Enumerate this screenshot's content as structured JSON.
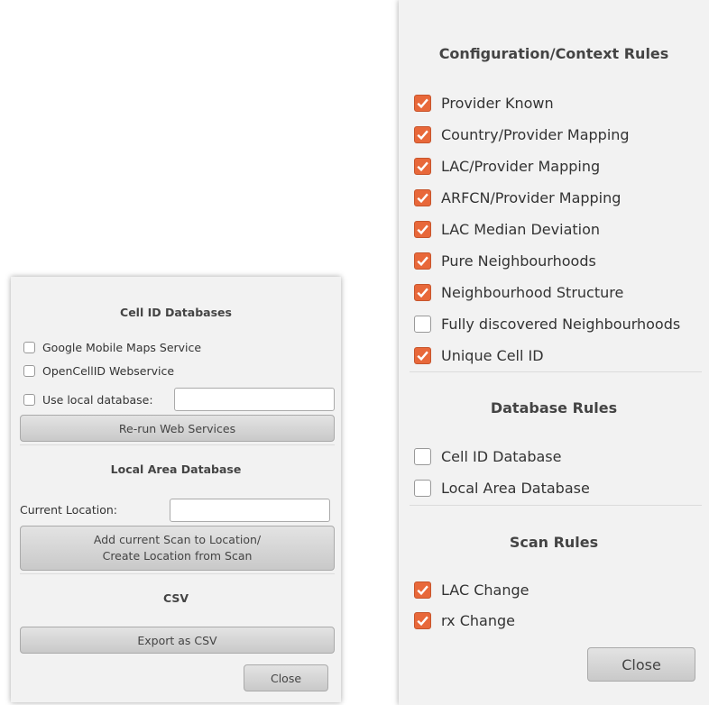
{
  "left_dialog": {
    "cell_id_title": "Cell ID Databases",
    "options": [
      {
        "label": "Google Mobile Maps Service",
        "checked": false
      },
      {
        "label": "OpenCellID Webservice",
        "checked": false
      },
      {
        "label": "Use local database:",
        "checked": false
      }
    ],
    "local_db_value": "",
    "rerun_button": "Re-run Web Services",
    "local_area_title": "Local Area Database",
    "current_location_label": "Current Location:",
    "current_location_value": "",
    "add_scan_button_line1": "Add current Scan to Location/",
    "add_scan_button_line2": "Create Location from Scan",
    "csv_title": "CSV",
    "export_button": "Export as CSV",
    "close_button": "Close"
  },
  "right_dialog": {
    "config_title": "Configuration/Context Rules",
    "config_rules": [
      {
        "label": "Provider Known",
        "checked": true
      },
      {
        "label": "Country/Provider Mapping",
        "checked": true
      },
      {
        "label": "LAC/Provider Mapping",
        "checked": true
      },
      {
        "label": "ARFCN/Provider Mapping",
        "checked": true
      },
      {
        "label": "LAC Median Deviation",
        "checked": true
      },
      {
        "label": "Pure Neighbourhoods",
        "checked": true
      },
      {
        "label": "Neighbourhood Structure",
        "checked": true
      },
      {
        "label": "Fully discovered Neighbourhoods",
        "checked": false
      },
      {
        "label": "Unique Cell ID",
        "checked": true
      }
    ],
    "database_title": "Database Rules",
    "database_rules": [
      {
        "label": "Cell ID Database",
        "checked": false
      },
      {
        "label": "Local Area Database",
        "checked": false
      }
    ],
    "scan_title": "Scan Rules",
    "scan_rules": [
      {
        "label": "LAC Change",
        "checked": true
      },
      {
        "label": "rx Change",
        "checked": true
      }
    ],
    "close_button": "Close"
  },
  "colors": {
    "checked_fill": "#e8683a",
    "panel_bg": "#f2f2f2"
  }
}
